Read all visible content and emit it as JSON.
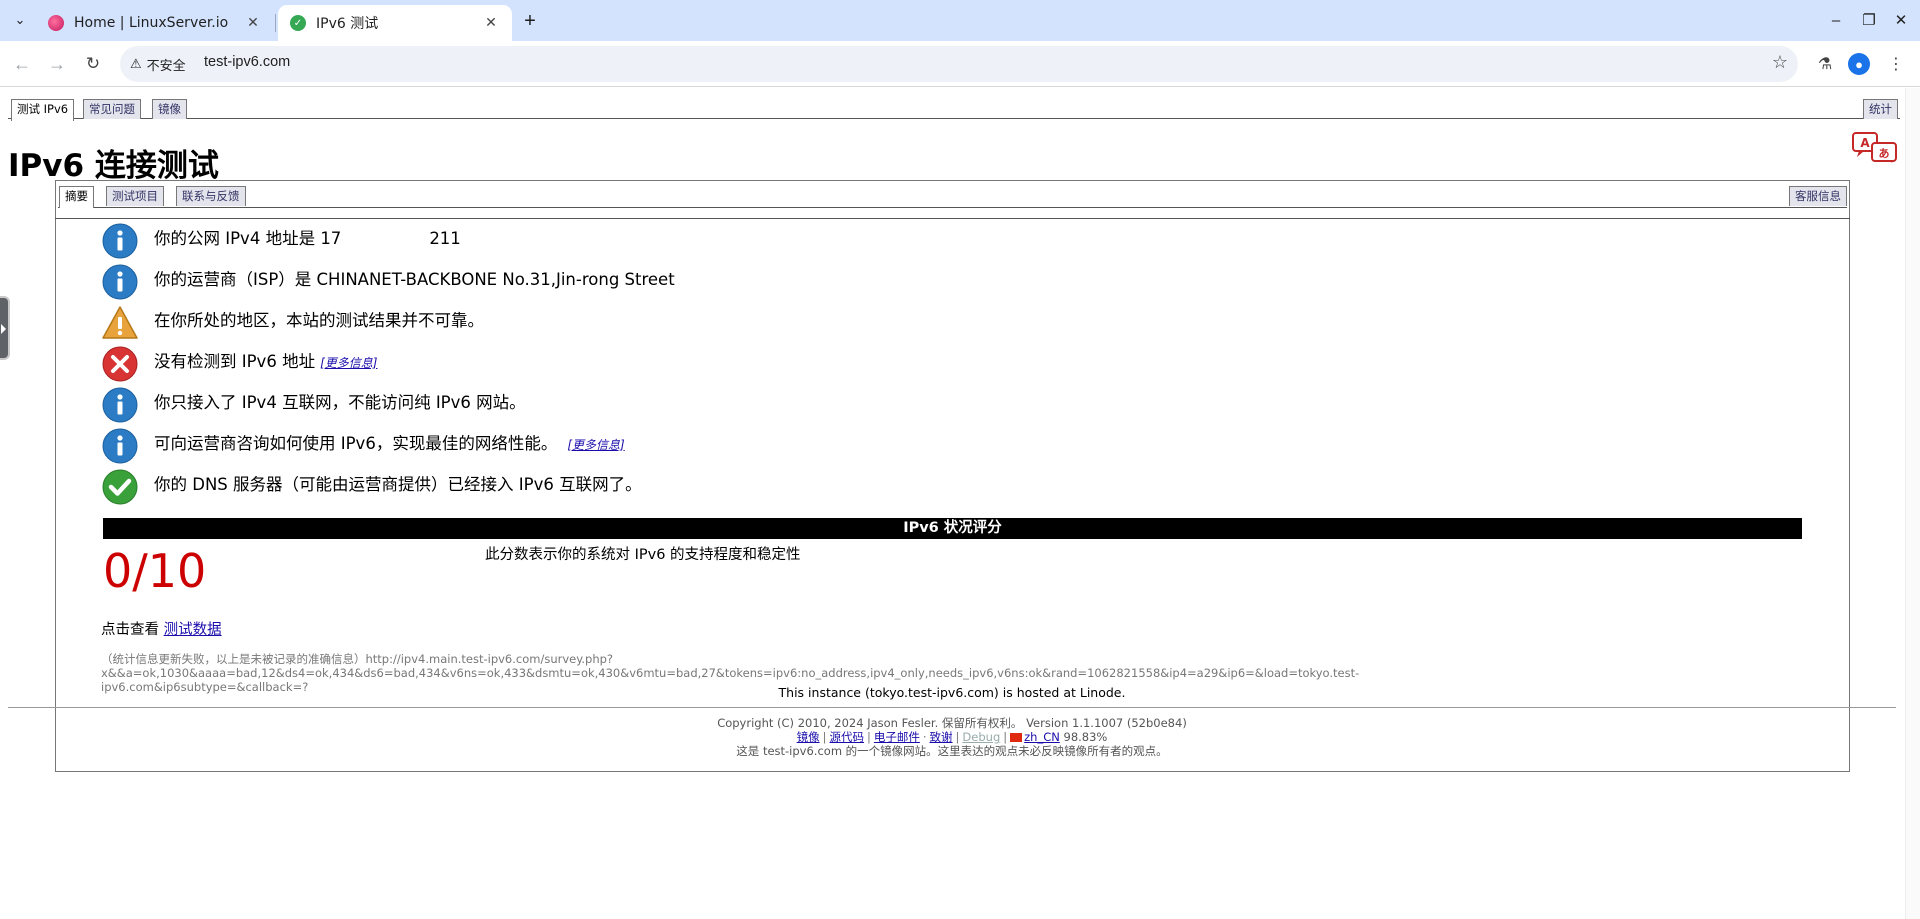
{
  "browser": {
    "tabs": [
      {
        "title": "Home | LinuxServer.io",
        "icon": "linuxserver-favicon"
      },
      {
        "title": "IPv6 测试",
        "icon": "checkmark-favicon"
      }
    ],
    "omnibox": {
      "security_label": "不安全",
      "url": "test-ipv6.com"
    }
  },
  "page": {
    "top_tabs": [
      "测试 IPv6",
      "常见问题",
      "镜像"
    ],
    "top_right_tab": "统计",
    "title": "IPv6 连接测试",
    "inner_tabs": [
      "摘要",
      "测试项目",
      "联系与反馈"
    ],
    "inner_right_tab": "客服信息",
    "messages": [
      {
        "icon": "info-icon",
        "text": "你的公网 IPv4 地址是 17",
        "tail": "211"
      },
      {
        "icon": "info-icon",
        "text": "你的运营商（ISP）是 CHINANET-BACKBONE No.31,Jin-rong Street"
      },
      {
        "icon": "warning-icon",
        "text": "在你所处的地区，本站的测试结果并不可靠。"
      },
      {
        "icon": "error-icon",
        "text": "没有检测到 IPv6 地址",
        "more": "[更多信息]"
      },
      {
        "icon": "info-icon",
        "text": "你只接入了 IPv4 互联网，不能访问纯 IPv6 网站。"
      },
      {
        "icon": "info-icon",
        "text": "可向运营商咨询如何使用 IPv6，实现最佳的网络性能。",
        "more": "[更多信息]"
      },
      {
        "icon": "success-icon",
        "text": "你的 DNS 服务器（可能由运营商提供）已经接入 IPv6 互联网了。"
      }
    ],
    "score_header": "IPv6 状况评分",
    "score": "0/10",
    "score_desc": "此分数表示你的系统对 IPv6 的支持程度和稳定性",
    "view_data_prefix": "点击查看",
    "view_data_link": "测试数据",
    "stats_line1": "（统计信息更新失败，以上是未被记录的准确信息）http://ipv4.main.test-ipv6.com/survey.php?",
    "stats_line2": "x&&a=ok,1030&aaaa=bad,12&ds4=ok,434&ds6=bad,434&v6ns=ok,433&dsmtu=ok,430&v6mtu=bad,27&tokens=ipv6:no_address,ipv4_only,needs_ipv6,v6ns:ok&rand=1062821558&ip4=a29&ip6=&load=tokyo.test-ipv6.com&ip6subtype=&callback=?",
    "hosted": "This instance (tokyo.test-ipv6.com) is hosted at Linode.",
    "footer": {
      "copyright": "Copyright (C) 2010, 2024 Jason Fesler. 保留所有权利。 Version 1.1.1007 (52b0e84)",
      "links": [
        "镜像",
        "源代码",
        "电子邮件",
        "致谢",
        "Debug",
        "zh_CN"
      ],
      "lang_pct": "98.83%",
      "mirror_note": "这是 test-ipv6.com 的一个镜像网站。这里表达的观点未必反映镜像所有者的观点。"
    }
  }
}
